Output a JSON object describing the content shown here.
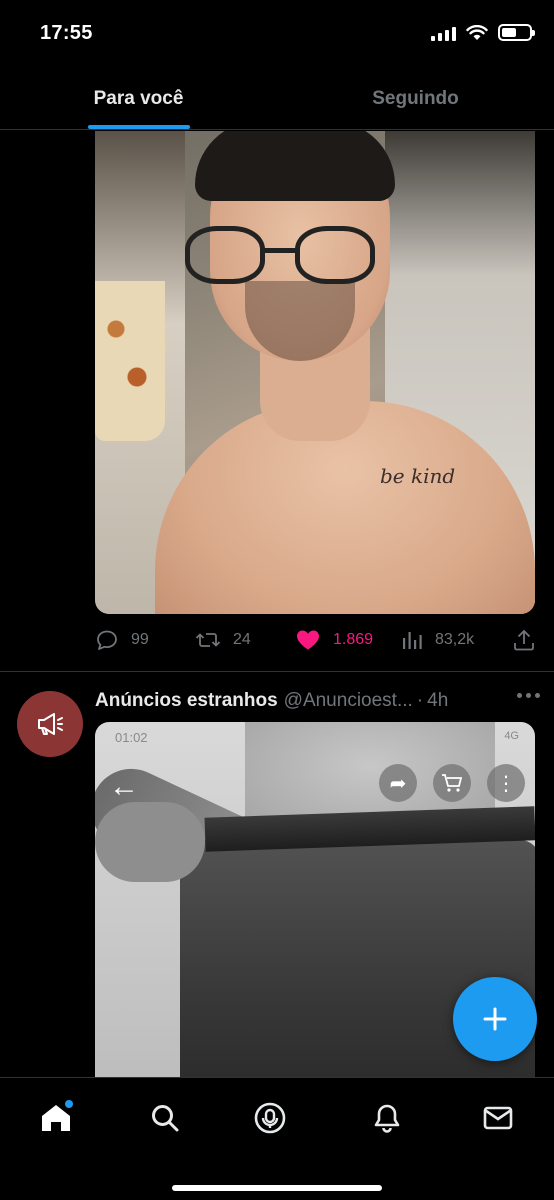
{
  "status_bar": {
    "time": "17:55"
  },
  "tabs": [
    {
      "label": "Para você",
      "active": true
    },
    {
      "label": "Seguindo",
      "active": false
    }
  ],
  "post1": {
    "tattoo_text": "be kind",
    "actions": {
      "replies": "99",
      "retweets": "24",
      "likes": "1.869",
      "views": "83,2k"
    },
    "liked": true
  },
  "post2": {
    "author_name": "Anúncios estranhos",
    "author_handle": "@Anuncioest...",
    "separator": "·",
    "time": "4h",
    "image": {
      "inner_time": "01:02",
      "inner_status": "4G"
    }
  },
  "colors": {
    "accent": "#1d9bf0",
    "like": "#f91880",
    "muted": "#71767b",
    "avatar": "#8c3535"
  },
  "icons": {
    "reply": "speech-bubble-icon",
    "retweet": "retweet-icon",
    "like": "heart-icon",
    "views": "bar-chart-icon",
    "share": "share-upload-icon",
    "compose": "plus-icon",
    "nav": [
      "home-icon",
      "search-icon",
      "spaces-microphone-icon",
      "bell-icon",
      "envelope-icon"
    ]
  }
}
